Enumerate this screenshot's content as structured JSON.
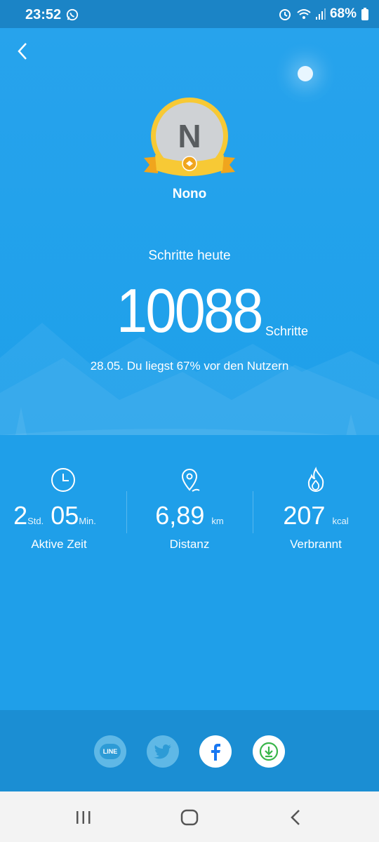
{
  "status_bar": {
    "time": "23:52",
    "battery": "68%",
    "icons": [
      "whatsapp-icon",
      "alarm-icon",
      "wifi-icon",
      "signal-icon",
      "battery-icon"
    ]
  },
  "profile": {
    "avatar_letter": "N",
    "name": "Nono"
  },
  "steps": {
    "label": "Schritte heute",
    "value": "10088",
    "unit": "Schritte",
    "comparison": "28.05. Du liegst 67% vor den Nutzern"
  },
  "stats": {
    "active_time": {
      "hours": "2",
      "hours_unit": "Std.",
      "minutes": "05",
      "minutes_unit": "Min.",
      "label": "Aktive Zeit",
      "icon": "clock-icon"
    },
    "distance": {
      "value": "6,89",
      "unit": "km",
      "label": "Distanz",
      "icon": "location-pin-icon"
    },
    "burned": {
      "value": "207",
      "unit": "kcal",
      "label": "Verbrannt",
      "icon": "flame-icon"
    }
  },
  "share": {
    "line_label": "LINE",
    "buttons": [
      "line-icon",
      "twitter-icon",
      "facebook-icon",
      "download-icon"
    ]
  },
  "colors": {
    "background": "#1f9fe9",
    "status_bar": "#1b84c6",
    "share_bar": "#1b8ed3",
    "nav_bar": "#f3f3f3",
    "medal_gold": "#f7c935",
    "line_green": "#39b54a",
    "facebook_blue": "#1877f2"
  }
}
